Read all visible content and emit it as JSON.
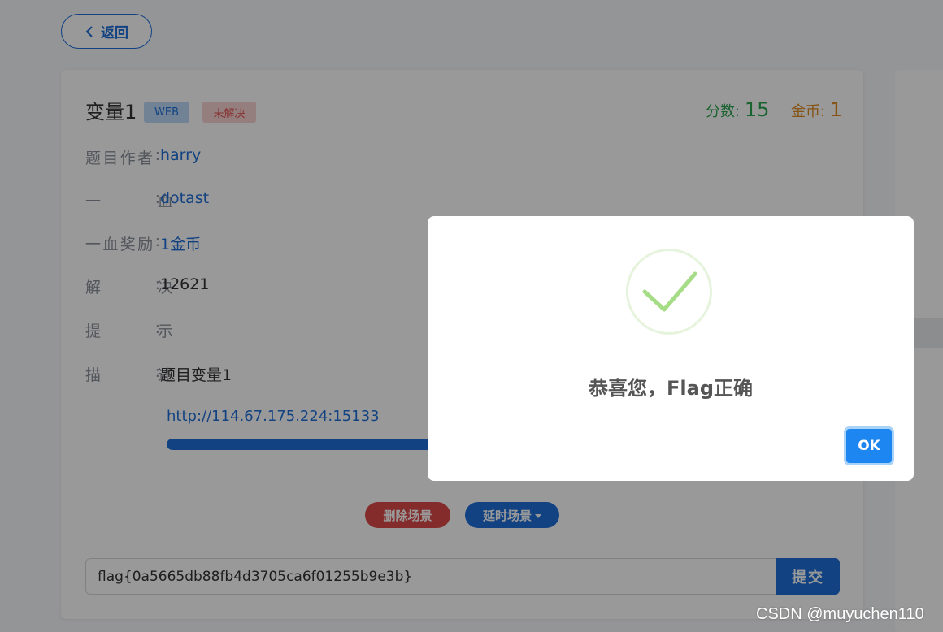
{
  "back_button": {
    "label": "返回",
    "icon": "chevron-left-icon"
  },
  "challenge": {
    "title": "变量1",
    "category_tag": "WEB",
    "status_tag": "未解决",
    "score_label": "分数:",
    "score_value": "15",
    "coins_label": "金币:",
    "coins_value": "1"
  },
  "details": [
    {
      "label_chars": [
        "题",
        "目",
        "作",
        "者",
        ":"
      ],
      "value": "harry",
      "link": true
    },
    {
      "label_chars": [
        "一",
        "血",
        ":"
      ],
      "value": "dotast",
      "link": true
    },
    {
      "label_chars": [
        "一",
        "血",
        "奖",
        "励",
        ":"
      ],
      "value": "1金币",
      "link": true
    },
    {
      "label_chars": [
        "解",
        "决",
        ":"
      ],
      "value": "12621",
      "link": false
    },
    {
      "label_chars": [
        "提",
        "示",
        ":"
      ],
      "value": "",
      "link": false
    },
    {
      "label_chars": [
        "描",
        "述",
        ":"
      ],
      "value": "题目变量1",
      "link": false
    }
  ],
  "scene": {
    "url": "http://114.67.175.224:15133",
    "progress_fraction": 1.0,
    "delete_label": "删除场景",
    "delay_label": "延时场景"
  },
  "flag_form": {
    "value": "flag{0a5665db88fb4d3705ca6f01255b9e3b}",
    "submit_label": "提交"
  },
  "modal": {
    "message": "恭喜您，Flag正确",
    "ok_label": "OK",
    "icon": "success-check-icon",
    "icon_color": "#a5dc86"
  },
  "watermark": "CSDN @muyuchen110",
  "colors": {
    "primary": "#1e6fd9",
    "danger": "#dc4a4a",
    "score": "#2aa551",
    "coins": "#e08a1e"
  }
}
